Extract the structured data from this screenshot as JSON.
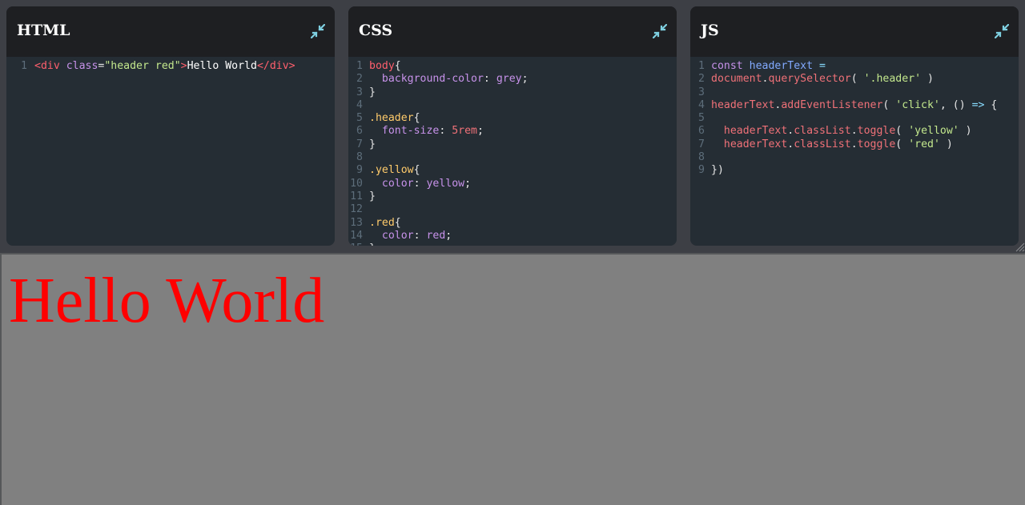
{
  "panels": {
    "html": {
      "title": "HTML",
      "lines": [
        [
          [
            "tok-tag",
            "<div "
          ],
          [
            "tok-attr",
            "class"
          ],
          [
            "tok-punct",
            "="
          ],
          [
            "tok-string",
            "\"header red\""
          ],
          [
            "tok-tag",
            ">"
          ],
          [
            "tok-text",
            "Hello World"
          ],
          [
            "tok-tag",
            "</div>"
          ]
        ]
      ]
    },
    "css": {
      "title": "CSS",
      "lines": [
        [
          [
            "tok-tag",
            "body"
          ],
          [
            "tok-punct",
            "{"
          ]
        ],
        [
          [
            "tok-prop",
            "  background-color"
          ],
          [
            "tok-punct",
            ": "
          ],
          [
            "tok-value",
            "grey"
          ],
          [
            "tok-punct",
            ";"
          ]
        ],
        [
          [
            "tok-punct",
            "}"
          ]
        ],
        [],
        [
          [
            "tok-class",
            ".header"
          ],
          [
            "tok-punct",
            "{"
          ]
        ],
        [
          [
            "tok-prop",
            "  font-size"
          ],
          [
            "tok-punct",
            ": "
          ],
          [
            "tok-number",
            "5rem"
          ],
          [
            "tok-punct",
            ";"
          ]
        ],
        [
          [
            "tok-punct",
            "}"
          ]
        ],
        [],
        [
          [
            "tok-class",
            ".yellow"
          ],
          [
            "tok-punct",
            "{"
          ]
        ],
        [
          [
            "tok-prop",
            "  color"
          ],
          [
            "tok-punct",
            ": "
          ],
          [
            "tok-value",
            "yellow"
          ],
          [
            "tok-punct",
            ";"
          ]
        ],
        [
          [
            "tok-punct",
            "}"
          ]
        ],
        [],
        [
          [
            "tok-class",
            ".red"
          ],
          [
            "tok-punct",
            "{"
          ]
        ],
        [
          [
            "tok-prop",
            "  color"
          ],
          [
            "tok-punct",
            ": "
          ],
          [
            "tok-value",
            "red"
          ],
          [
            "tok-punct",
            ";"
          ]
        ],
        [
          [
            "tok-punct",
            "}"
          ]
        ]
      ]
    },
    "js": {
      "title": "JS",
      "lines": [
        [
          [
            "tok-keyword",
            "const "
          ],
          [
            "tok-var",
            "headerText"
          ],
          [
            "tok-op",
            " ="
          ]
        ],
        [
          [
            "tok-fn",
            "document"
          ],
          [
            "tok-punct",
            "."
          ],
          [
            "tok-fn",
            "querySelector"
          ],
          [
            "tok-punct",
            "( "
          ],
          [
            "tok-string",
            "'.header'"
          ],
          [
            "tok-punct",
            " )"
          ]
        ],
        [],
        [
          [
            "tok-fn",
            "headerText"
          ],
          [
            "tok-punct",
            "."
          ],
          [
            "tok-fn",
            "addEventListener"
          ],
          [
            "tok-punct",
            "( "
          ],
          [
            "tok-string",
            "'click'"
          ],
          [
            "tok-punct",
            ", () "
          ],
          [
            "tok-op",
            "=>"
          ],
          [
            "tok-punct",
            " {"
          ]
        ],
        [],
        [
          [
            "tok-fn",
            "  headerText"
          ],
          [
            "tok-punct",
            "."
          ],
          [
            "tok-fn",
            "classList"
          ],
          [
            "tok-punct",
            "."
          ],
          [
            "tok-fn",
            "toggle"
          ],
          [
            "tok-punct",
            "( "
          ],
          [
            "tok-string",
            "'yellow'"
          ],
          [
            "tok-punct",
            " )"
          ]
        ],
        [
          [
            "tok-fn",
            "  headerText"
          ],
          [
            "tok-punct",
            "."
          ],
          [
            "tok-fn",
            "classList"
          ],
          [
            "tok-punct",
            "."
          ],
          [
            "tok-fn",
            "toggle"
          ],
          [
            "tok-punct",
            "( "
          ],
          [
            "tok-string",
            "'red'"
          ],
          [
            "tok-punct",
            " )"
          ]
        ],
        [],
        [
          [
            "tok-punct",
            "})"
          ]
        ]
      ]
    }
  },
  "icons": {
    "collapse": "collapse-arrows-icon",
    "resize": "resize-grip-icon",
    "color": "#7ecfe0"
  },
  "preview": {
    "header_text": "Hello World",
    "background": "#808080",
    "text_color": "#ff0000"
  }
}
